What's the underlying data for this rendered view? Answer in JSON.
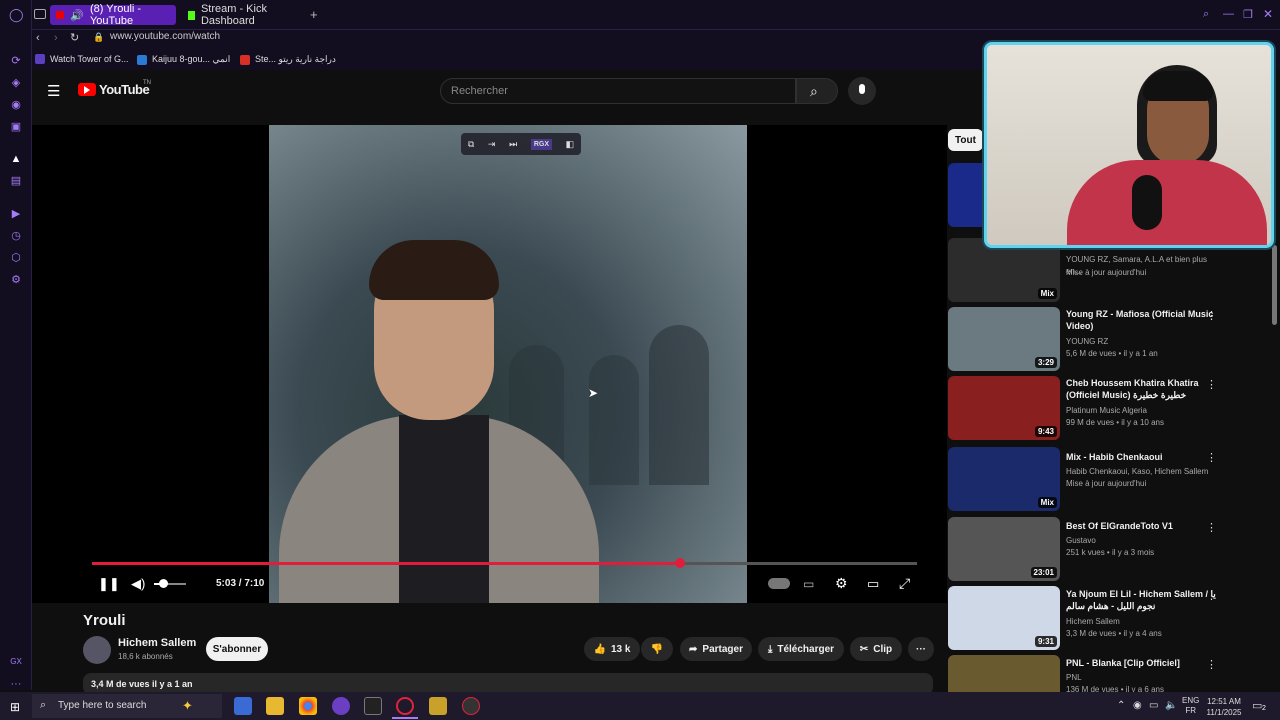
{
  "browser": {
    "tabs": [
      {
        "label": "(8) Yrouli - YouTube",
        "active": true
      },
      {
        "label": "Stream - Kick Dashboard",
        "active": false
      }
    ],
    "new_tab": "+",
    "url": "www.youtube.com/watch",
    "bookmarks": [
      {
        "label": "Watch Tower of G...",
        "color": "#5a3fbf"
      },
      {
        "label": "Kaijuu 8-gou... انمي",
        "color": "#2a7bd4"
      },
      {
        "label": "Ste... دراجة نارية ريتو",
        "color": "#d93025"
      }
    ]
  },
  "youtube": {
    "logo_text": "YouTube",
    "logo_suffix": "TN",
    "search_placeholder": "Rechercher",
    "video": {
      "title": "Yrouli",
      "time": "5:03 / 7:10",
      "progress": 0.705,
      "overlay_buttons": [
        "RGX"
      ]
    },
    "channel": {
      "name": "Hichem Sallem",
      "subscribers": "18,6 k abonnés",
      "subscribe_label": "S'abonner"
    },
    "actions": {
      "likes": "13 k",
      "share": "Partager",
      "download": "Télécharger",
      "clip": "Clip"
    },
    "description_meta": "3,4 M de vues  il y a 1 an",
    "filter_chip": "Tout",
    "recommendations": [
      {
        "title": "",
        "channel": "YOUNG RZ, Samara, A.L.A et bien plus en...",
        "meta": "Mise à jour aujourd'hui",
        "badge": "Mix",
        "thumb": "#3a3a3a"
      },
      {
        "title": "Young RZ - Mafiosa (Official Music Video)",
        "channel": "YOUNG RZ",
        "meta": "5,6 M de vues • il y a 1 an",
        "badge": "3:29",
        "thumb": "#6b7a80"
      },
      {
        "title": "Cheb Houssem Khatira Khatira (Officiel Music) خطيرة خطيرة",
        "channel": "Platinum Music Algeria",
        "meta": "99 M de vues • il y a 10 ans",
        "badge": "9:43",
        "thumb": "#8a1f1f"
      },
      {
        "title": "Mix - Habib Chenkaoui",
        "channel": "Habib Chenkaoui, Kaso, Hichem Sallem ...",
        "meta": "Mise à jour aujourd'hui",
        "badge": "Mix",
        "thumb": "#1a2a6a"
      },
      {
        "title": "Best Of ElGrandeToto V1",
        "channel": "Gustavo",
        "meta": "251 k vues • il y a 3 mois",
        "badge": "23:01",
        "thumb": "#555"
      },
      {
        "title": "Ya Njoum El Lil - Hichem Sallem / يا نجوم الليل - هشام سالم",
        "channel": "Hichem Sallem",
        "meta": "3,3 M de vues • il y a 4 ans",
        "badge": "9:31",
        "thumb": "#cfd8e6"
      },
      {
        "title": "PNL - Blanka [Clip Officiel]",
        "channel": "PNL",
        "meta": "136 M de vues • il y a 6 ans",
        "badge": "",
        "thumb": "#6a5a30"
      }
    ]
  },
  "taskbar": {
    "search_placeholder": "Type here to search",
    "lang_top": "ENG",
    "lang_bottom": "FR",
    "time": "12:51 AM",
    "date": "11/1/2025",
    "notifications": "2"
  },
  "sidebar_bottom_label": "GX"
}
